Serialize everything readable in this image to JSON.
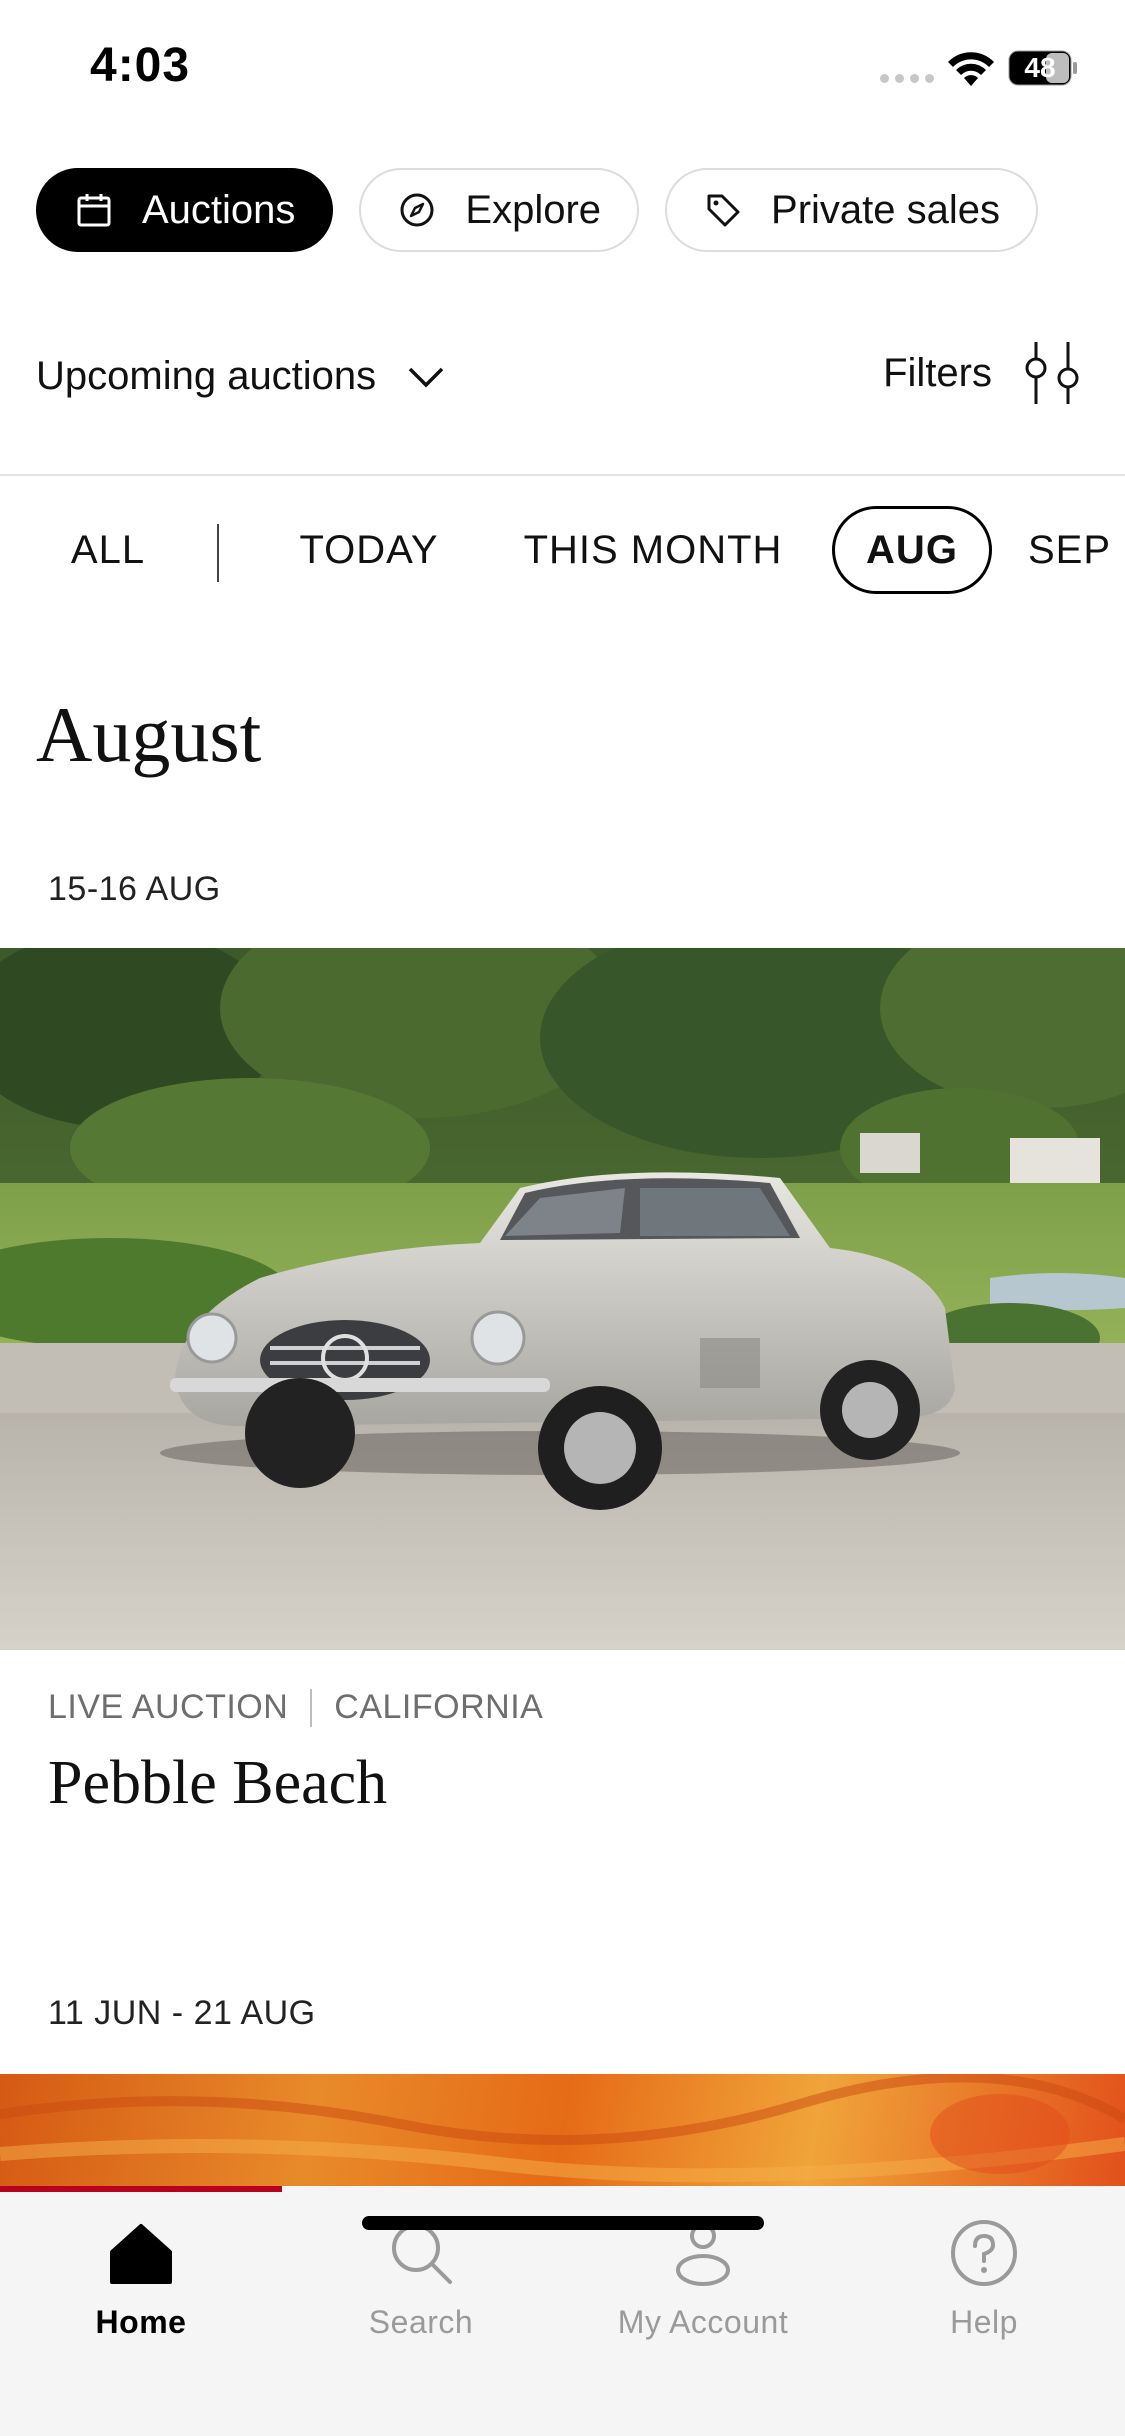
{
  "status_bar": {
    "time": "4:03",
    "battery": "48"
  },
  "top_tabs": [
    {
      "label": "Auctions",
      "icon": "calendar-icon",
      "active": true
    },
    {
      "label": "Explore",
      "icon": "compass-icon",
      "active": false
    },
    {
      "label": "Private sales",
      "icon": "tag-icon",
      "active": false
    }
  ],
  "sort": {
    "label": "Upcoming auctions",
    "icon": "chevron-down-icon"
  },
  "filters": {
    "label": "Filters",
    "icon": "sliders-icon"
  },
  "month_tabs": [
    {
      "label": "ALL",
      "selected": false
    },
    {
      "label": "TODAY",
      "selected": false
    },
    {
      "label": "THIS MONTH",
      "selected": false
    },
    {
      "label": "AUG",
      "selected": true
    },
    {
      "label": "SEP",
      "selected": false
    }
  ],
  "section": {
    "heading": "August"
  },
  "auctions": [
    {
      "date": "15-16 AUG",
      "image": "car-photo",
      "type": "LIVE AUCTION",
      "location": "CALIFORNIA",
      "title": "Pebble Beach"
    },
    {
      "date": "11 JUN - 21 AUG",
      "image": "orange-painting-photo"
    }
  ],
  "bottom_nav": [
    {
      "label": "Home",
      "icon": "home-icon",
      "current": true
    },
    {
      "label": "Search",
      "icon": "search-icon",
      "current": false
    },
    {
      "label": "My Account",
      "icon": "account-icon",
      "current": false
    },
    {
      "label": "Help",
      "icon": "help-icon",
      "current": false
    }
  ],
  "colors": {
    "accent": "#b8001f",
    "active_pill": "#000000",
    "muted_text": "#9a9a9a"
  }
}
